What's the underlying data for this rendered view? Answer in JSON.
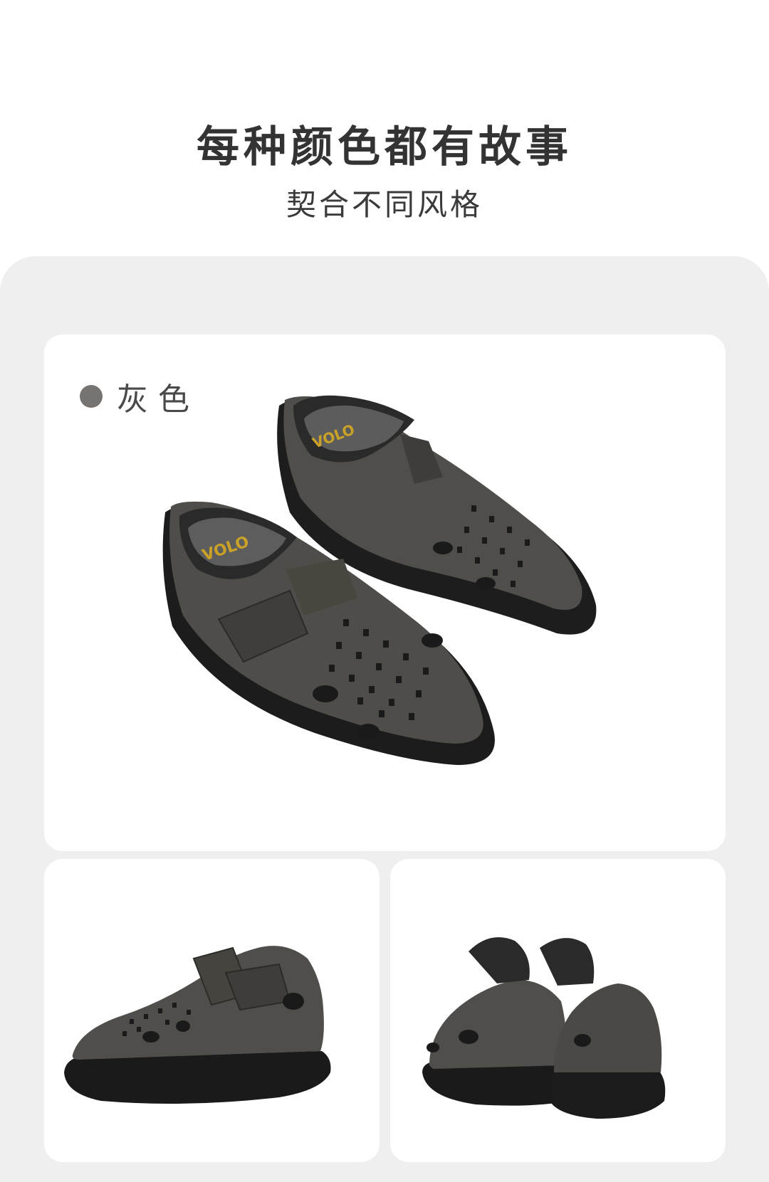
{
  "header": {
    "title": "每种颜色都有故事",
    "subtitle": "契合不同风格"
  },
  "main_card": {
    "color_name": "灰色",
    "swatch_color": "#767370",
    "insole_brand": "VOLO"
  },
  "colors": {
    "page_bg": "#ffffff",
    "panel_bg": "#efefef",
    "card_bg": "#ffffff",
    "shoe_upper": "#4e4d49",
    "shoe_sole": "#1a1a1a"
  }
}
